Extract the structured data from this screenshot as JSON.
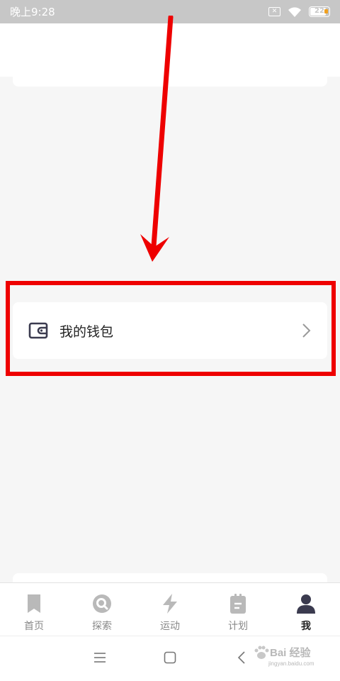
{
  "status_bar": {
    "time": "晚上9:28",
    "battery_level": "22",
    "icons": [
      "sim-x-icon",
      "wifi-icon",
      "battery-icon"
    ]
  },
  "wallet": {
    "label": "我的钱包",
    "icon": "wallet-icon",
    "arrow_icon": "chevron-right-icon"
  },
  "tab_bar": {
    "tabs": [
      {
        "label": "首页",
        "icon": "bookmark-icon",
        "active": false
      },
      {
        "label": "探索",
        "icon": "explore-icon",
        "active": false
      },
      {
        "label": "运动",
        "icon": "lightning-icon",
        "active": false
      },
      {
        "label": "计划",
        "icon": "plan-icon",
        "active": false
      },
      {
        "label": "我",
        "icon": "person-icon",
        "active": true
      }
    ]
  },
  "system_nav": {
    "buttons": [
      "menu-icon",
      "home-icon",
      "back-icon"
    ]
  },
  "watermark": {
    "logo": "Bai 经验",
    "url": "jingyan.baidu.com"
  },
  "colors": {
    "highlight": "#ee0000",
    "status_bar_bg": "#c7c7c7",
    "page_bg": "#f6f6f6",
    "active_icon": "#3b3b4f",
    "inactive_icon": "#b9b9b9"
  }
}
